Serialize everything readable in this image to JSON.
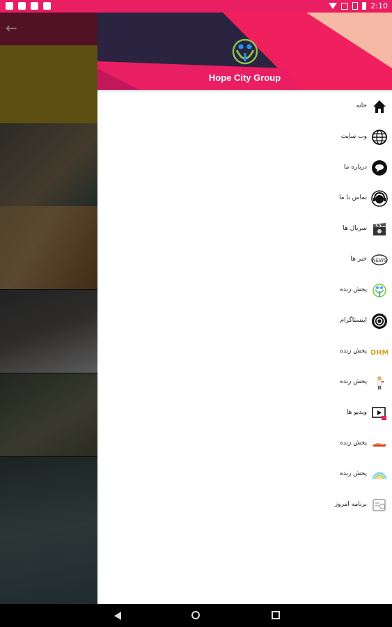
{
  "status_bar": {
    "time": "2:10",
    "left_icons": [
      "notification-icon",
      "image-icon",
      "instagram-icon",
      "app-icon"
    ],
    "right_icons": [
      "wifi-icon",
      "vibrate-icon",
      "no-sim-icon",
      "battery-icon"
    ]
  },
  "background_app": {
    "back_icon": "arrow-left-icon"
  },
  "drawer": {
    "header": {
      "brand": "Hope City Group",
      "logo_icon": "hope-city-logo-icon"
    },
    "items": [
      {
        "label": "خانه",
        "icon": "home-icon"
      },
      {
        "label": "وب سایت",
        "icon": "globe-icon"
      },
      {
        "label": "درباره ما",
        "icon": "chat-bubble-icon"
      },
      {
        "label": "تماس با ما",
        "icon": "headset-icon"
      },
      {
        "label": "سریال ها",
        "icon": "clapperboard-icon"
      },
      {
        "label": "خبر ها",
        "icon": "news-icon"
      },
      {
        "label": "پخش زنده",
        "icon": "hope-logo-icon"
      },
      {
        "label": "اینستاگرام",
        "icon": "instagram-icon"
      },
      {
        "label": "پخش زنده",
        "icon": "ohm-logo-icon"
      },
      {
        "label": "پخش زنده",
        "icon": "figure-icon"
      },
      {
        "label": "ویدیو ها",
        "icon": "video-icon"
      },
      {
        "label": "پخش زنده",
        "icon": "shoe-logo-icon"
      },
      {
        "label": "پخش زنده",
        "icon": "rainbow-icon"
      },
      {
        "label": "برنامه امروز",
        "icon": "schedule-icon"
      }
    ]
  },
  "nav_bar": {
    "icons": [
      "nav-back-icon",
      "nav-home-icon",
      "nav-recents-icon"
    ]
  },
  "colors": {
    "status_bar": "#e91e63",
    "header_dark": "#2a2440",
    "header_pink": "#e91e63"
  }
}
